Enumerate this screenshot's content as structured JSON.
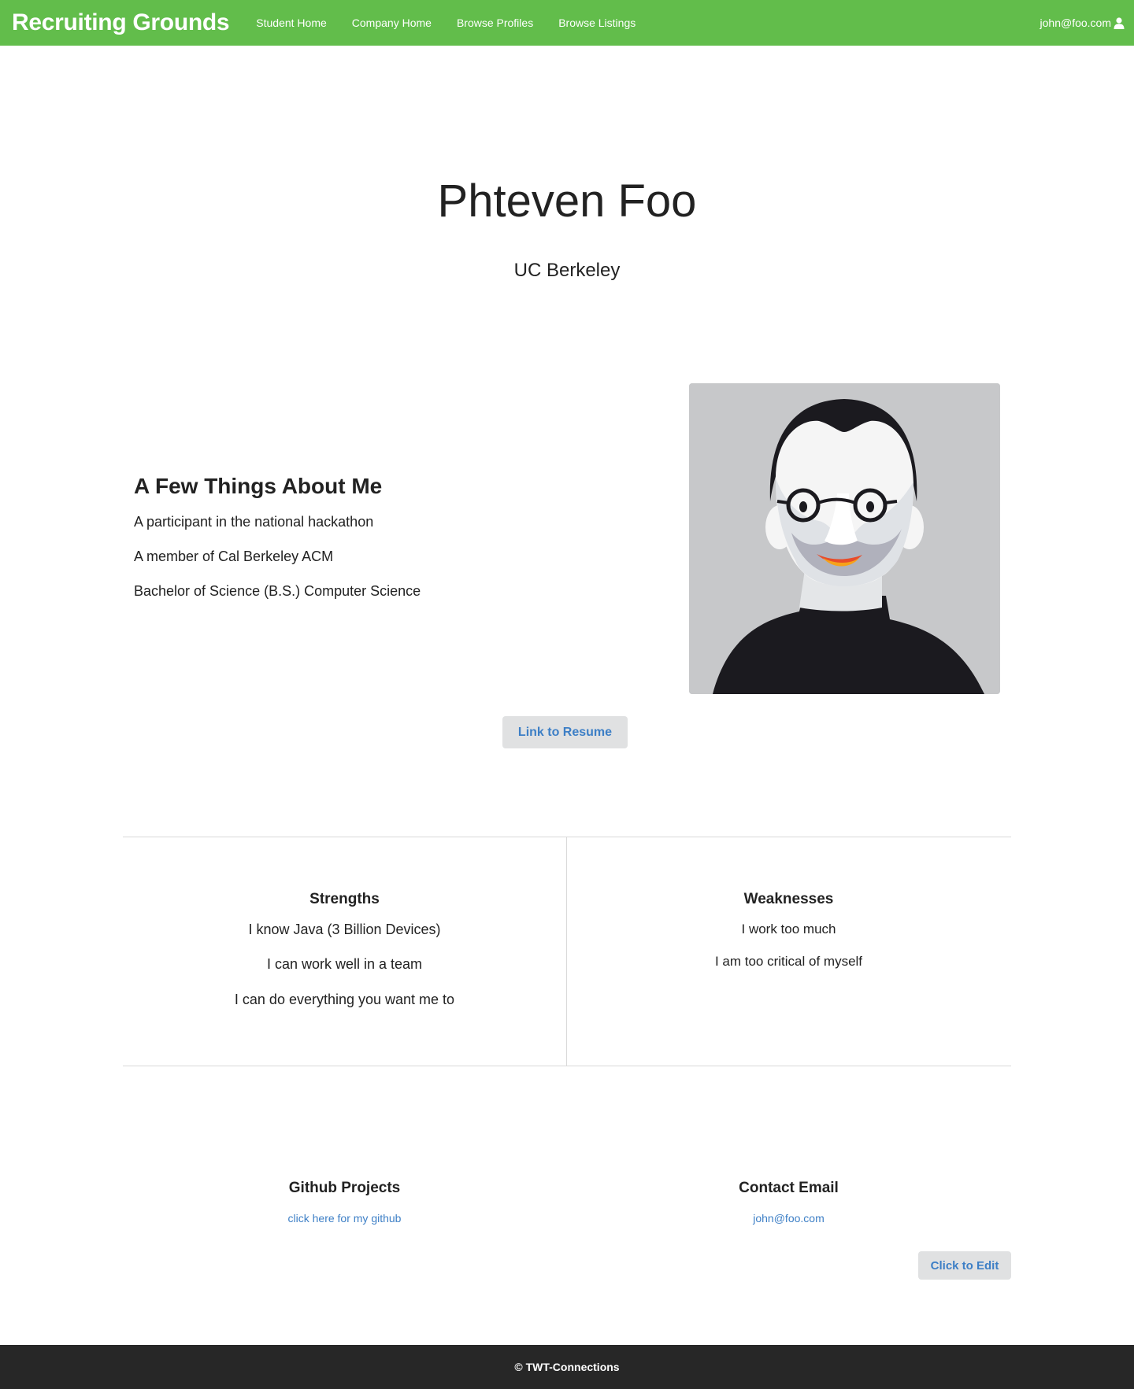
{
  "navbar": {
    "brand": "Recruiting Grounds",
    "links": [
      "Student Home",
      "Company Home",
      "Browse Profiles",
      "Browse Listings"
    ],
    "user_email": "john@foo.com",
    "user_icon": "user-icon",
    "background": "#62bd4b"
  },
  "profile": {
    "name": "Phteven Foo",
    "school": "UC Berkeley"
  },
  "about": {
    "title": "A Few Things About Me",
    "items": [
      "A participant in the national hackathon",
      "A member of Cal Berkeley ACM",
      "Bachelor of Science (B.S.) Computer Science"
    ]
  },
  "resume_button": "Link to Resume",
  "strengths": {
    "title": "Strengths",
    "items": [
      "I know Java (3 Billion Devices)",
      "I can work well in a team",
      "I can do everything you want me to"
    ]
  },
  "weaknesses": {
    "title": "Weaknesses",
    "items": [
      "I work too much",
      "I am too critical of myself"
    ]
  },
  "github": {
    "title": "Github Projects",
    "link": "click here for my github"
  },
  "contact": {
    "title": "Contact Email",
    "email": "john@foo.com"
  },
  "edit_button": "Click to Edit",
  "footer": {
    "text": "© TWT-Connections",
    "background": "#272727"
  },
  "colors": {
    "link": "#3d7fc6",
    "button_bg": "#e0e1e2",
    "divider": "#d9d9d9"
  }
}
